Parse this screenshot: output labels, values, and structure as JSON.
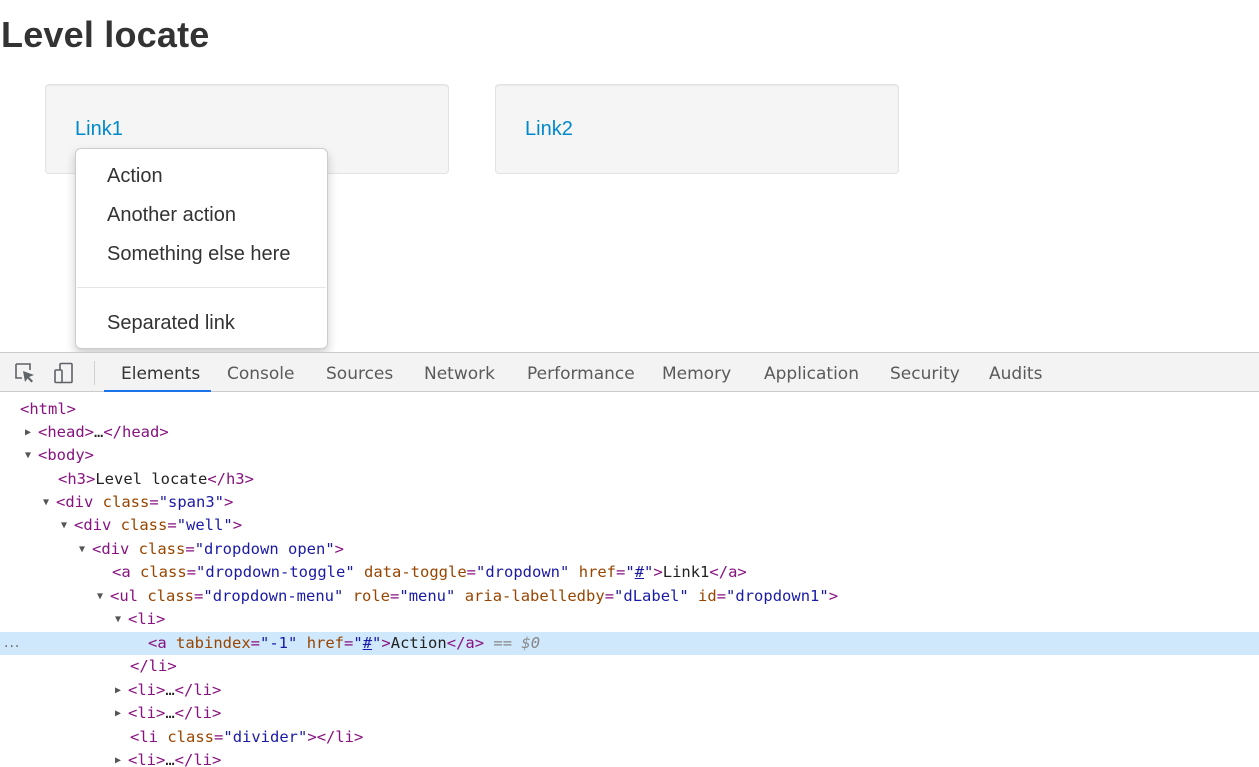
{
  "page": {
    "title": "Level locate",
    "wells": [
      {
        "link": "Link1"
      },
      {
        "link": "Link2"
      }
    ],
    "dropdown": {
      "items": [
        "Action",
        "Another action",
        "Something else here"
      ],
      "separated": "Separated link"
    }
  },
  "devtools": {
    "tools": [
      {
        "icon": "inspect-element-icon"
      },
      {
        "icon": "device-toolbar-icon"
      }
    ],
    "tabs": [
      "Elements",
      "Console",
      "Sources",
      "Network",
      "Performance",
      "Memory",
      "Application",
      "Security",
      "Audits"
    ],
    "active_tab": "Elements",
    "selection_colors": {
      "accent": "#1a73e8",
      "selected_row": "#cfe8fc"
    },
    "dom": {
      "html_open": "<html>",
      "head_open": "<head>",
      "ellipsis": "…",
      "head_close": "</head>",
      "body_open": "<body>",
      "h3_open": "<h3>",
      "h3_text": "Level locate",
      "h3_close": "</h3>",
      "div_open": "<div",
      "class_attr": "class",
      "span3": "\"span3\"",
      "gt": ">",
      "well": "\"well\"",
      "dropdown_open_cls": "\"dropdown open\"",
      "a_open": "<a",
      "dropdown_toggle": "\"dropdown-toggle\"",
      "data_toggle_attr": "data-toggle",
      "dropdown_val": "\"dropdown\"",
      "href_attr": "href",
      "hash": "#",
      "quote": "\"",
      "link1_text": "Link1",
      "a_close": "</a>",
      "ul_open": "<ul",
      "dropdown_menu_cls": "\"dropdown-menu\"",
      "role_attr": "role",
      "menu_val": "\"menu\"",
      "aria_attr": "aria-labelledby",
      "dlabel_val": "\"dLabel\"",
      "id_attr": "id",
      "dropdown1_val": "\"dropdown1\"",
      "li_open": "<li>",
      "tabindex_attr": "tabindex",
      "tabindex_val": "\"-1\"",
      "action_text": "Action",
      "eq_marker": "== $0",
      "li_close": "</li>",
      "li_collapsed_open": "<li>",
      "li_collapsed_close": "</li>",
      "li_divider_open": "<li",
      "divider_val": "\"divider\"",
      "li_divider_close": "></li>",
      "row_dots": "..."
    }
  }
}
